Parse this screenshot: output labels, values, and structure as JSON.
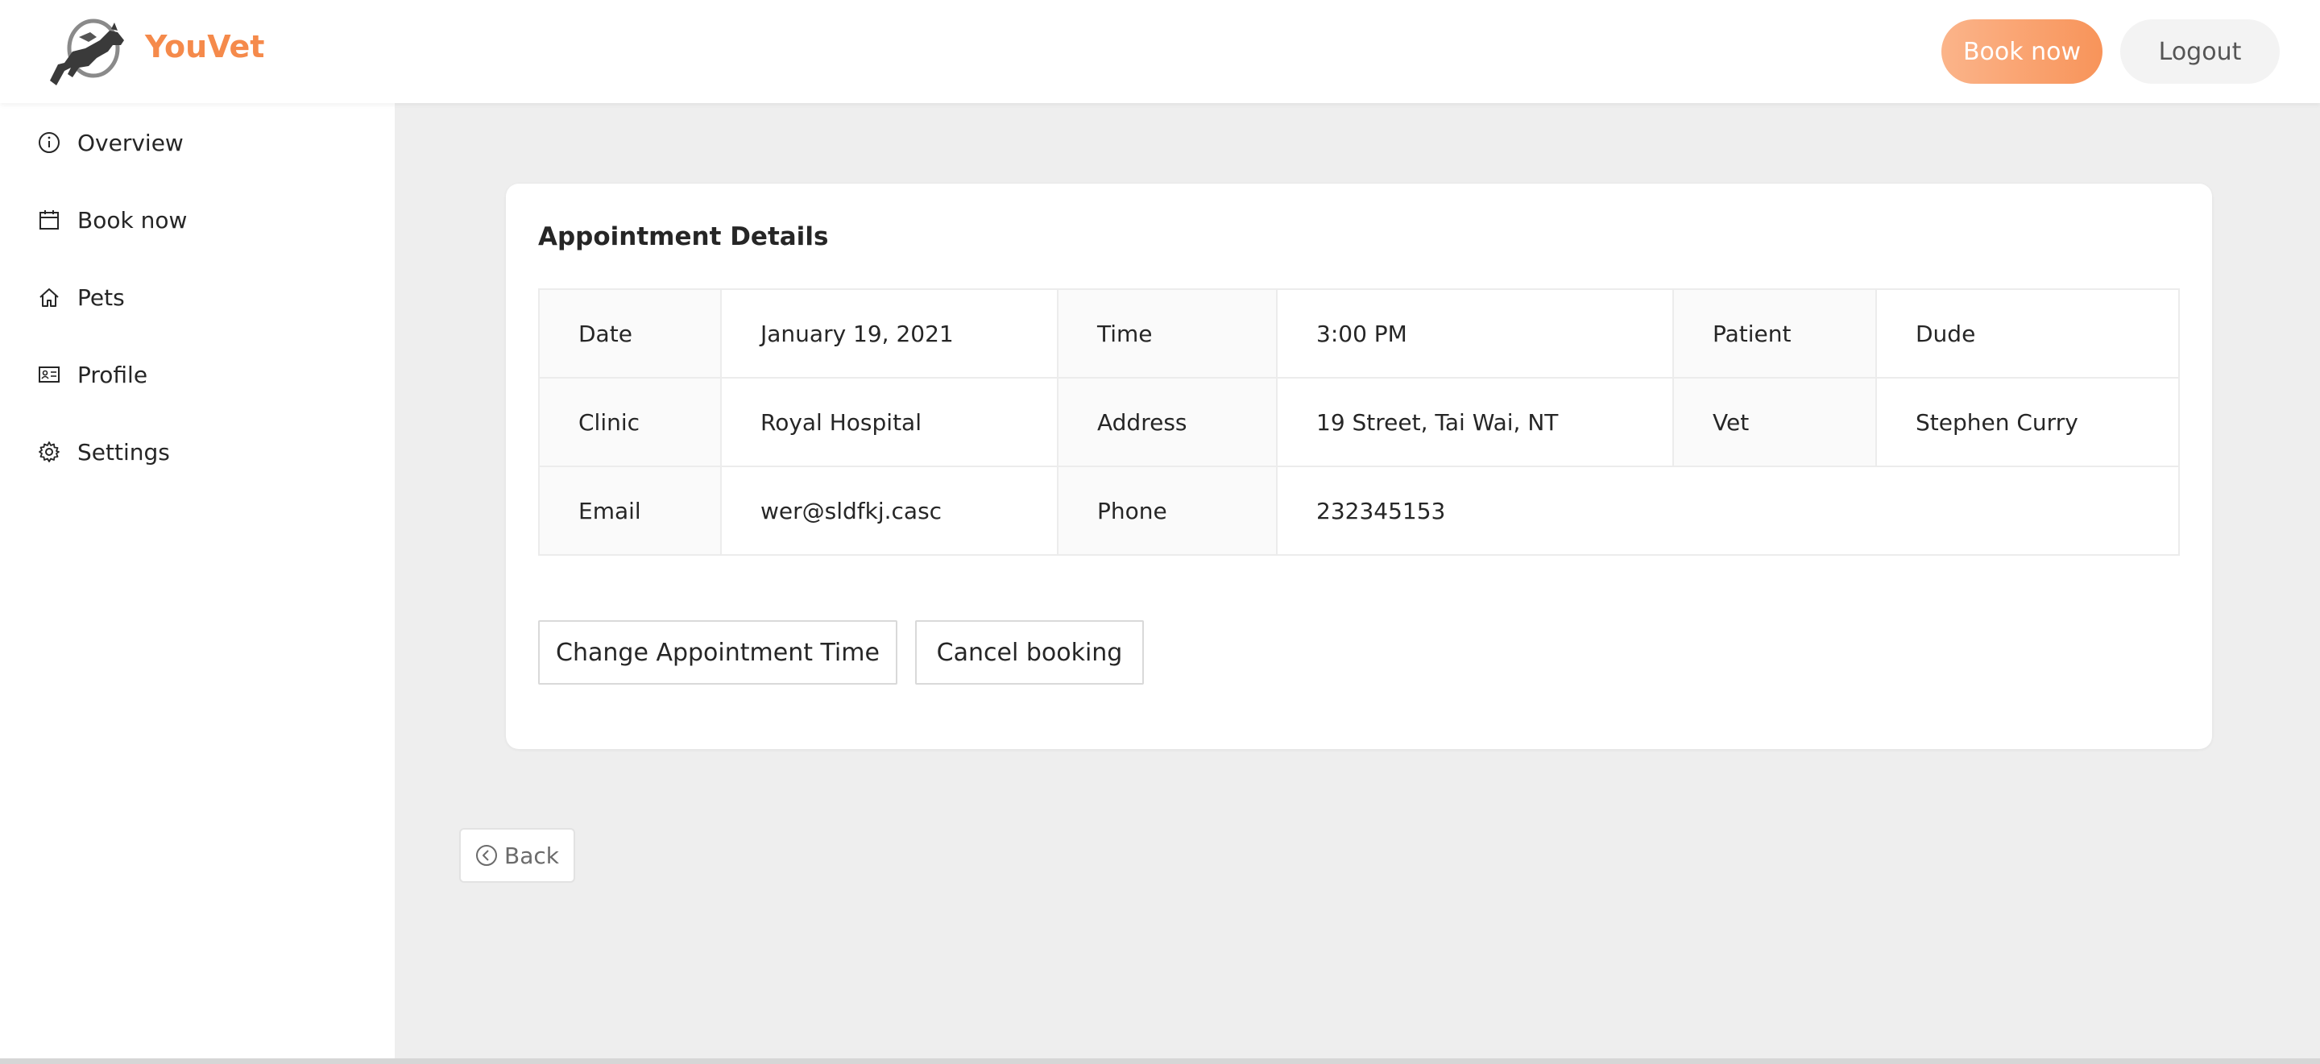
{
  "header": {
    "brand": "YouVet",
    "book_now_label": "Book now",
    "logout_label": "Logout"
  },
  "sidebar": {
    "items": [
      {
        "label": "Overview",
        "icon": "info-circle-icon"
      },
      {
        "label": "Book now",
        "icon": "calendar-icon"
      },
      {
        "label": "Pets",
        "icon": "home-icon"
      },
      {
        "label": "Profile",
        "icon": "id-card-icon"
      },
      {
        "label": "Settings",
        "icon": "gear-icon"
      }
    ]
  },
  "appointment": {
    "title": "Appointment Details",
    "rows": [
      [
        {
          "label": "Date",
          "value": "January 19, 2021"
        },
        {
          "label": "Time",
          "value": "3:00 PM"
        },
        {
          "label": "Patient",
          "value": "Dude"
        }
      ],
      [
        {
          "label": "Clinic",
          "value": "Royal Hospital"
        },
        {
          "label": "Address",
          "value": "19 Street, Tai Wai, NT"
        },
        {
          "label": "Vet",
          "value": "Stephen Curry"
        }
      ],
      [
        {
          "label": "Email",
          "value": "wer@sldfkj.casc"
        },
        {
          "label": "Phone",
          "value": "232345153"
        }
      ]
    ],
    "change_time_label": "Change Appointment Time",
    "cancel_label": "Cancel booking"
  },
  "back_label": "Back",
  "colors": {
    "brand": "#f58a4b",
    "book_button_gradient_start": "#fbb48a",
    "book_button_gradient_end": "#f8945a",
    "main_background": "#eeeeee"
  }
}
